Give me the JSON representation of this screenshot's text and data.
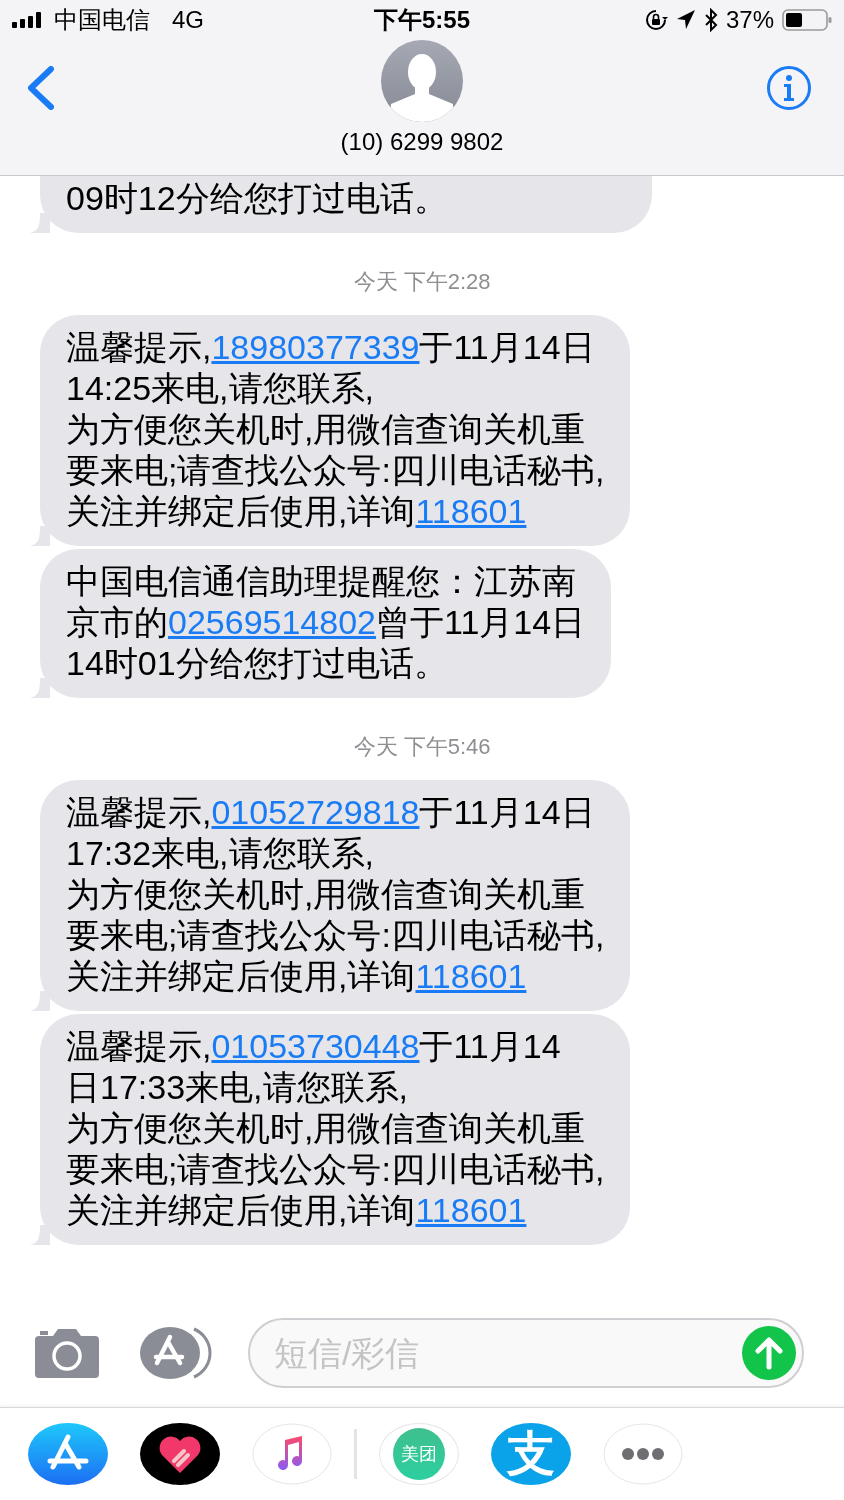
{
  "status_bar": {
    "carrier": "中国电信",
    "network": "4G",
    "time": "下午5:55",
    "battery": "37%"
  },
  "header": {
    "contact": "(10) 6299 9802"
  },
  "messages": [
    {
      "kind": "bubble",
      "lines": [
        [
          {
            "text": "09时12分给您打过电话。"
          }
        ]
      ]
    },
    {
      "kind": "timestamp",
      "text": "今天 下午2:28"
    },
    {
      "kind": "bubble",
      "lines": [
        [
          {
            "text": "温馨提示,"
          },
          {
            "text": "18980377339",
            "link": true
          },
          {
            "text": "于11月14日"
          }
        ],
        [
          {
            "text": "14:25来电,请您联系,"
          }
        ],
        [
          {
            "text": "为方便您关机时,用微信查询关机重"
          }
        ],
        [
          {
            "text": "要来电;请查找公众号:四川电话秘书,"
          }
        ],
        [
          {
            "text": "关注并绑定后使用,详询"
          },
          {
            "text": "118601",
            "link": true
          }
        ]
      ]
    },
    {
      "kind": "bubble",
      "lines": [
        [
          {
            "text": "中国电信通信助理提醒您：江苏南"
          }
        ],
        [
          {
            "text": "京市的"
          },
          {
            "text": "02569514802",
            "link": true
          },
          {
            "text": "曾于11月14日"
          }
        ],
        [
          {
            "text": "14时01分给您打过电话。"
          }
        ]
      ]
    },
    {
      "kind": "timestamp",
      "text": "今天 下午5:46"
    },
    {
      "kind": "bubble",
      "lines": [
        [
          {
            "text": "温馨提示,"
          },
          {
            "text": "01052729818",
            "link": true
          },
          {
            "text": "于11月14日"
          }
        ],
        [
          {
            "text": "17:32来电,请您联系,"
          }
        ],
        [
          {
            "text": "为方便您关机时,用微信查询关机重"
          }
        ],
        [
          {
            "text": "要来电;请查找公众号:四川电话秘书,"
          }
        ],
        [
          {
            "text": "关注并绑定后使用,详询"
          },
          {
            "text": "118601",
            "link": true
          }
        ]
      ]
    },
    {
      "kind": "bubble",
      "lines": [
        [
          {
            "text": "温馨提示,"
          },
          {
            "text": "01053730448",
            "link": true
          },
          {
            "text": "于11月14"
          }
        ],
        [
          {
            "text": "日17:33来电,请您联系,"
          }
        ],
        [
          {
            "text": "为方便您关机时,用微信查询关机重"
          }
        ],
        [
          {
            "text": "要来电;请查找公众号:四川电话秘书,"
          }
        ],
        [
          {
            "text": "关注并绑定后使用,详询"
          },
          {
            "text": "118601",
            "link": true
          }
        ]
      ]
    }
  ],
  "composer": {
    "placeholder": "短信/彩信"
  },
  "app_drawer": [
    {
      "kind": "appstore"
    },
    {
      "kind": "heart"
    },
    {
      "kind": "music"
    },
    {
      "kind": "meituan",
      "label": "美团"
    },
    {
      "kind": "alipay",
      "label": "支"
    },
    {
      "kind": "more"
    }
  ]
}
